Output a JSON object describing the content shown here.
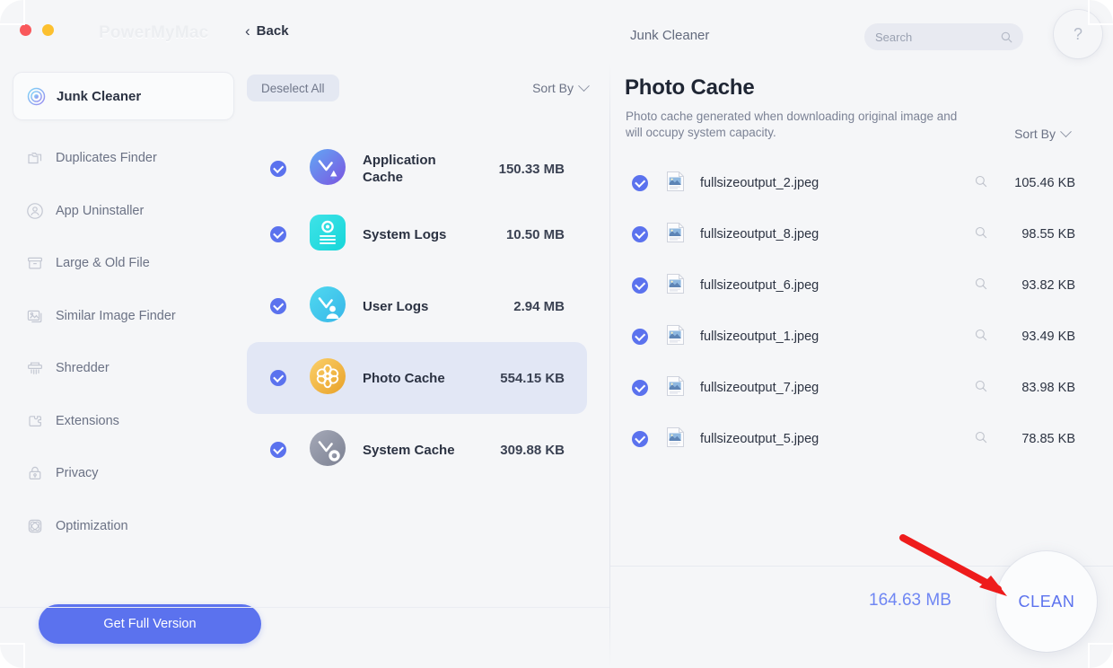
{
  "window": {
    "brand": "PowerMyMac",
    "back_label": "Back",
    "module_title": "Junk Cleaner",
    "help_label": "?"
  },
  "search": {
    "placeholder": "Search",
    "value": "",
    "icon": "search-icon"
  },
  "sidebar": {
    "items": [
      {
        "label": "Junk Cleaner",
        "icon": "target-radar-icon",
        "active": true
      },
      {
        "label": "Duplicates Finder",
        "icon": "duplicate-folder-icon",
        "active": false
      },
      {
        "label": "App Uninstaller",
        "icon": "app-uninstall-icon",
        "active": false
      },
      {
        "label": "Large & Old File",
        "icon": "file-box-icon",
        "active": false
      },
      {
        "label": "Similar Image Finder",
        "icon": "image-stack-icon",
        "active": false
      },
      {
        "label": "Shredder",
        "icon": "shredder-icon",
        "active": false
      },
      {
        "label": "Extensions",
        "icon": "extensions-puzzle-icon",
        "active": false
      },
      {
        "label": "Privacy",
        "icon": "lock-icon",
        "active": false
      },
      {
        "label": "Optimization",
        "icon": "optimization-icon",
        "active": false
      }
    ],
    "get_full_version": "Get Full Version"
  },
  "middle": {
    "deselect_all": "Deselect All",
    "sort_by": "Sort By",
    "categories": [
      {
        "name": "Application\nCache",
        "name_line1": "Application",
        "name_line2": "Cache",
        "size": "150.33 MB",
        "checked": true,
        "selected": false,
        "icon": "application-cache-icon"
      },
      {
        "name": "System Logs",
        "name_line1": "System Logs",
        "name_line2": "",
        "size": "10.50 MB",
        "checked": true,
        "selected": false,
        "icon": "system-logs-icon"
      },
      {
        "name": "User Logs",
        "name_line1": "User Logs",
        "name_line2": "",
        "size": "2.94 MB",
        "checked": true,
        "selected": false,
        "icon": "user-logs-icon"
      },
      {
        "name": "Photo Cache",
        "name_line1": "Photo Cache",
        "name_line2": "",
        "size": "554.15 KB",
        "checked": true,
        "selected": true,
        "icon": "photo-cache-icon"
      },
      {
        "name": "System Cache",
        "name_line1": "System Cache",
        "name_line2": "",
        "size": "309.88 KB",
        "checked": true,
        "selected": false,
        "icon": "system-cache-icon"
      }
    ]
  },
  "detail": {
    "title": "Photo Cache",
    "description": "Photo cache generated when downloading original image and will occupy system capacity.",
    "sort_by": "Sort By",
    "files": [
      {
        "name": "fullsizeoutput_2.jpeg",
        "size": "105.46 KB",
        "checked": true
      },
      {
        "name": "fullsizeoutput_8.jpeg",
        "size": "98.55 KB",
        "checked": true
      },
      {
        "name": "fullsizeoutput_6.jpeg",
        "size": "93.82 KB",
        "checked": true
      },
      {
        "name": "fullsizeoutput_1.jpeg",
        "size": "93.49 KB",
        "checked": true
      },
      {
        "name": "fullsizeoutput_7.jpeg",
        "size": "83.98 KB",
        "checked": true
      },
      {
        "name": "fullsizeoutput_5.jpeg",
        "size": "78.85 KB",
        "checked": true
      }
    ]
  },
  "footer": {
    "total_size": "164.63 MB",
    "clean_label": "CLEAN"
  },
  "annotation": {
    "arrow_color": "#ee1c1c",
    "points_to": "clean-button"
  },
  "colors": {
    "accent": "#5b72ee",
    "total_text": "#6f86f3",
    "background": "#f5f6f8",
    "selected_row": "#e2e7f5",
    "traffic_red": "#f9585b",
    "traffic_yellow": "#fcc02f"
  }
}
